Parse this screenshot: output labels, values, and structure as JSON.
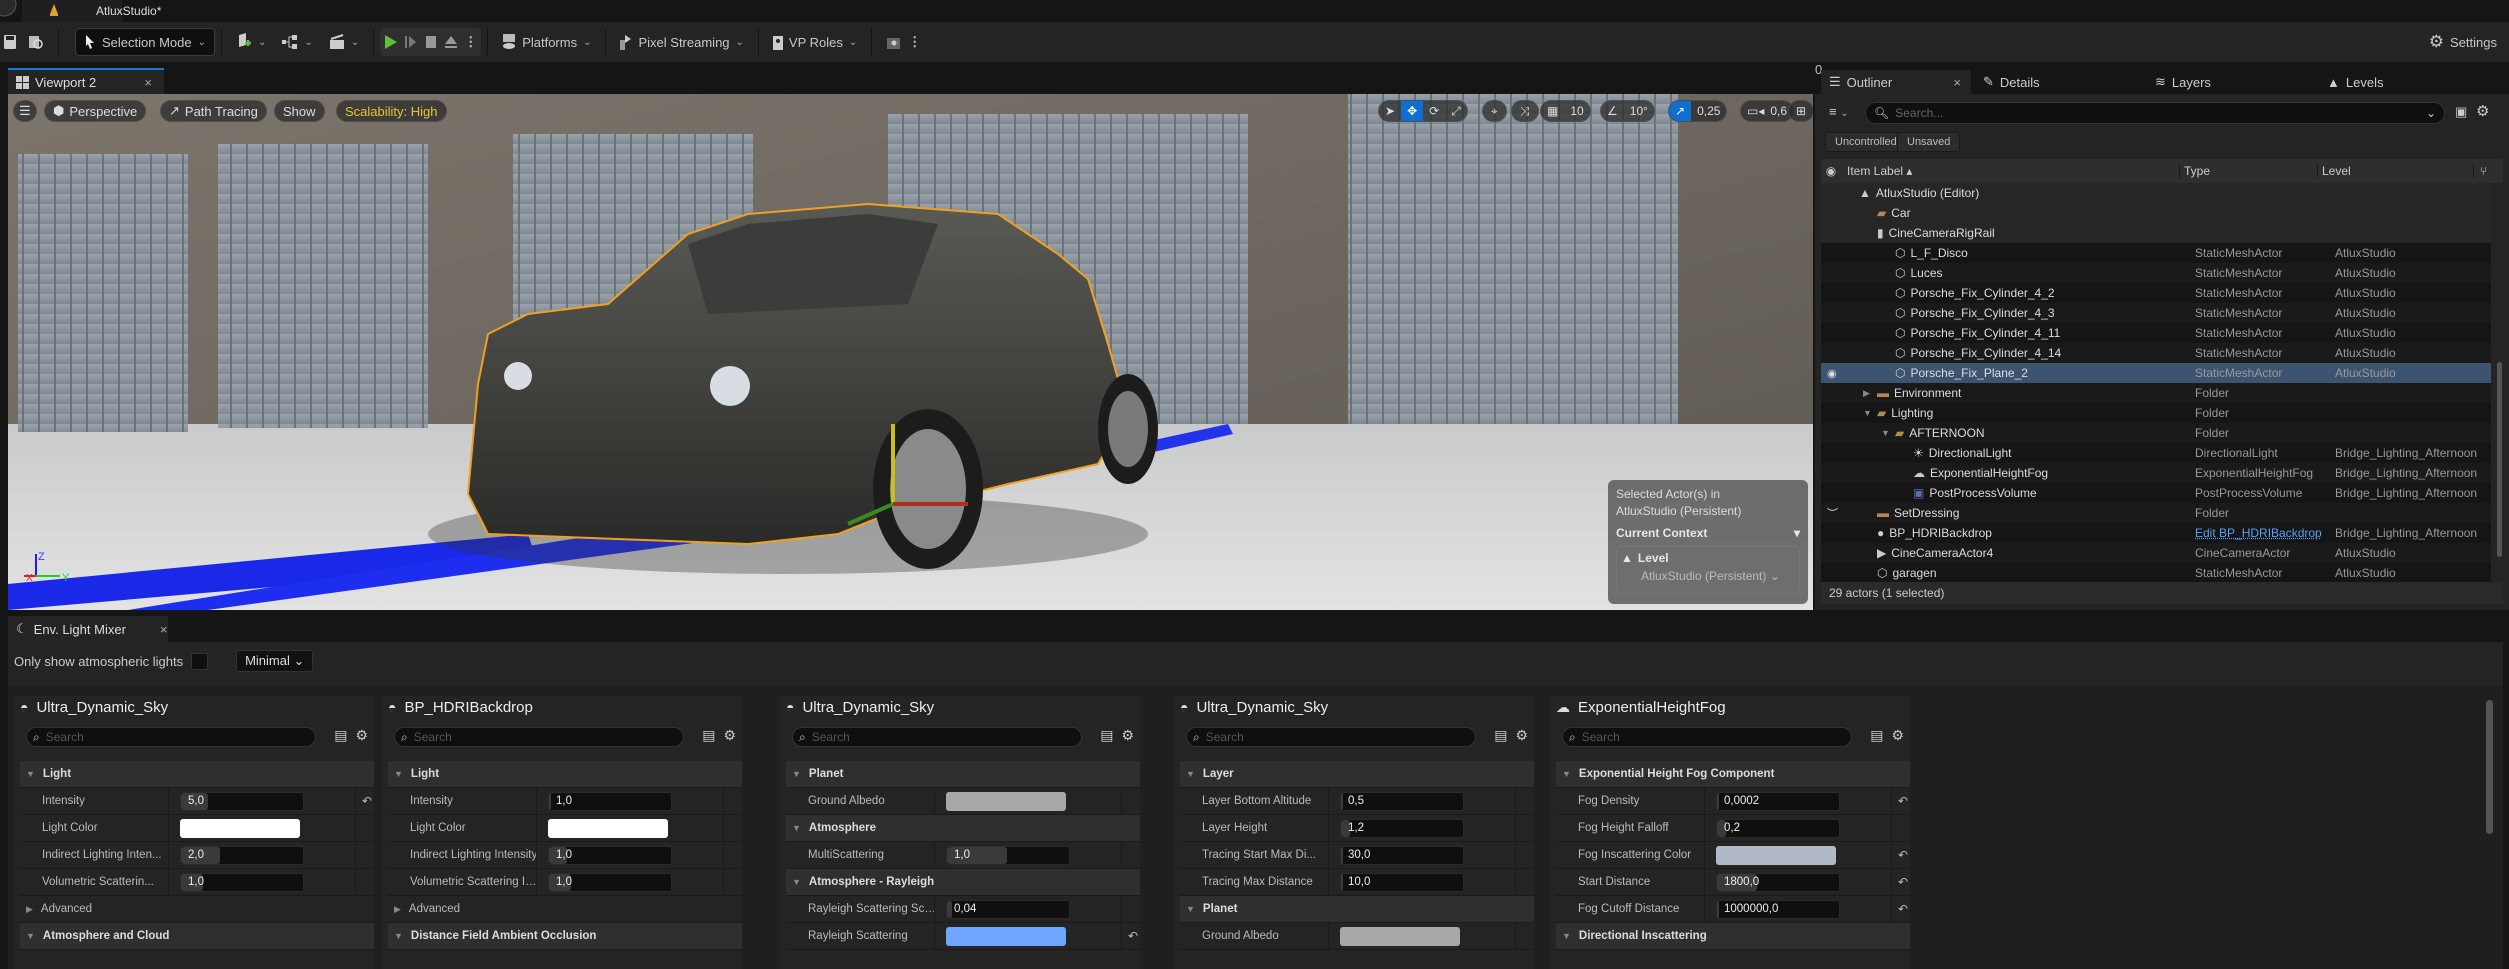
{
  "title_bar": {
    "doc_title": "AtluxStudio*"
  },
  "toolbar": {
    "selection_mode": "Selection Mode",
    "platforms": "Platforms",
    "pixel_streaming": "Pixel Streaming",
    "vp_roles": "VP Roles",
    "settings": "Settings"
  },
  "viewport": {
    "tab_label": "Viewport 2",
    "view_mode": "Perspective",
    "render_mode": "Path Tracing",
    "show": "Show",
    "scalability": "Scalability: High",
    "grid_snap": "10",
    "rotation_snap": "10°",
    "scale_snap": "0,25",
    "camera_speed": "0,6",
    "axis_labels": {
      "z": "Z",
      "y": "Y",
      "x": "X"
    },
    "context_box": {
      "line1": "Selected Actor(s) in",
      "line2": "AtluxStudio (Persistent)",
      "heading": "Current Context",
      "level_label": "Level",
      "level_value": "AtluxStudio (Persistent)"
    }
  },
  "outliner": {
    "tabs": [
      "Outliner",
      "Details",
      "Layers",
      "Levels"
    ],
    "search_placeholder": "Search...",
    "chips": [
      "Uncontrolled",
      "Unsaved"
    ],
    "columns": {
      "label": "Item Label",
      "type": "Type",
      "level": "Level"
    },
    "rows": [
      {
        "label": "AtluxStudio (Editor)",
        "type": "",
        "level": "",
        "icon": "level-icon",
        "indent": 1,
        "kind": "folder"
      },
      {
        "label": "Car",
        "type": "",
        "level": "",
        "icon": "folder-open-icon",
        "indent": 2,
        "kind": "folder"
      },
      {
        "label": "CineCameraRigRail",
        "type": "",
        "level": "",
        "icon": "camera-rail-icon",
        "indent": 2,
        "kind": "folder"
      },
      {
        "label": "L_F_Disco",
        "type": "StaticMeshActor",
        "level": "AtluxStudio",
        "icon": "static-mesh-icon",
        "indent": 3
      },
      {
        "label": "Luces",
        "type": "StaticMeshActor",
        "level": "AtluxStudio",
        "icon": "static-mesh-icon",
        "indent": 3
      },
      {
        "label": "Porsche_Fix_Cylinder_4_2",
        "type": "StaticMeshActor",
        "level": "AtluxStudio",
        "icon": "static-mesh-icon",
        "indent": 3
      },
      {
        "label": "Porsche_Fix_Cylinder_4_3",
        "type": "StaticMeshActor",
        "level": "AtluxStudio",
        "icon": "static-mesh-icon",
        "indent": 3
      },
      {
        "label": "Porsche_Fix_Cylinder_4_11",
        "type": "StaticMeshActor",
        "level": "AtluxStudio",
        "icon": "static-mesh-icon",
        "indent": 3
      },
      {
        "label": "Porsche_Fix_Cylinder_4_14",
        "type": "StaticMeshActor",
        "level": "AtluxStudio",
        "icon": "static-mesh-icon",
        "indent": 3
      },
      {
        "label": "Porsche_Fix_Plane_2",
        "type": "StaticMeshActor",
        "level": "AtluxStudio",
        "icon": "static-mesh-icon",
        "indent": 3,
        "selected": true
      },
      {
        "label": "Environment",
        "type": "Folder",
        "level": "",
        "icon": "folder-icon",
        "indent": 2,
        "arrow": "right"
      },
      {
        "label": "Lighting",
        "type": "Folder",
        "level": "",
        "icon": "folder-open-icon",
        "indent": 2,
        "arrow": "down"
      },
      {
        "label": "AFTERNOON",
        "type": "Folder",
        "level": "",
        "icon": "folder-open-icon",
        "indent": 3,
        "arrow": "down"
      },
      {
        "label": "DirectionalLight",
        "type": "DirectionalLight",
        "level": "Bridge_Lighting_Afternoon",
        "icon": "directional-light-icon",
        "indent": 4
      },
      {
        "label": "ExponentialHeightFog",
        "type": "ExponentialHeightFog",
        "level": "Bridge_Lighting_Afternoon",
        "icon": "fog-icon",
        "indent": 4
      },
      {
        "label": "PostProcessVolume",
        "type": "PostProcessVolume",
        "level": "Bridge_Lighting_Afternoon",
        "icon": "post-process-icon",
        "indent": 4
      },
      {
        "label": "SetDressing",
        "type": "Folder",
        "level": "",
        "icon": "folder-icon",
        "indent": 2,
        "hidden": true
      },
      {
        "label": "BP_HDRIBackdrop",
        "type": "Edit BP_HDRIBackdrop",
        "level": "Bridge_Lighting_Afternoon",
        "icon": "blueprint-icon",
        "indent": 2,
        "link": true
      },
      {
        "label": "CineCameraActor4",
        "type": "CineCameraActor",
        "level": "AtluxStudio",
        "icon": "cine-camera-icon",
        "indent": 2
      },
      {
        "label": "garagen",
        "type": "StaticMeshActor",
        "level": "AtluxStudio",
        "icon": "static-mesh-icon",
        "indent": 2
      }
    ],
    "status": "29 actors (1 selected)"
  },
  "mixer": {
    "tab_label": "Env. Light Mixer",
    "only_atmospheric_label": "Only show atmospheric lights",
    "only_atmospheric_checked": false,
    "view_mode": "Minimal",
    "search_placeholder": "Search",
    "panels": [
      {
        "title": "Ultra_Dynamic_Sky",
        "icon": "sky-icon",
        "rows": [
          {
            "kind": "cat",
            "label": "Light",
            "open": true
          },
          {
            "kind": "num",
            "label": "Intensity",
            "value": "5,0",
            "fill": 0.22,
            "reset": true
          },
          {
            "kind": "color",
            "label": "Light Color",
            "color": "#ffffff"
          },
          {
            "kind": "num",
            "label": "Indirect Lighting Inten...",
            "value": "2,0",
            "fill": 0.32
          },
          {
            "kind": "num",
            "label": "Volumetric Scatterin...",
            "value": "1,0",
            "fill": 0.18
          },
          {
            "kind": "cat",
            "label": "Advanced",
            "open": false,
            "sub": true
          },
          {
            "kind": "cat",
            "label": "Atmosphere and Cloud",
            "open": true
          }
        ]
      },
      {
        "title": "BP_HDRIBackdrop",
        "icon": "sky-icon",
        "rows": [
          {
            "kind": "cat",
            "label": "Light",
            "open": true
          },
          {
            "kind": "num",
            "label": "Intensity",
            "value": "1,0",
            "fill": 0.02
          },
          {
            "kind": "color",
            "label": "Light Color",
            "color": "#ffffff"
          },
          {
            "kind": "num",
            "label": "Indirect Lighting Intensity",
            "value": "1,0",
            "fill": 0.15
          },
          {
            "kind": "num",
            "label": "Volumetric Scattering In...",
            "value": "1,0",
            "fill": 0.18
          },
          {
            "kind": "cat",
            "label": "Advanced",
            "open": false,
            "sub": true
          },
          {
            "kind": "cat",
            "label": "Distance Field Ambient Occlusion",
            "open": true
          }
        ]
      },
      {
        "title": "Ultra_Dynamic_Sky",
        "icon": "sky-icon",
        "rows": [
          {
            "kind": "cat",
            "label": "Planet",
            "open": true
          },
          {
            "kind": "color",
            "label": "Ground Albedo",
            "color": "#a8a8a8"
          },
          {
            "kind": "cat",
            "label": "Atmosphere",
            "open": true
          },
          {
            "kind": "num",
            "label": "MultiScattering",
            "value": "1,0",
            "fill": 0.49
          },
          {
            "kind": "cat",
            "label": "Atmosphere - Rayleigh",
            "open": true
          },
          {
            "kind": "num",
            "label": "Rayleigh Scattering Scale",
            "value": "0,04",
            "fill": 0.04
          },
          {
            "kind": "color",
            "label": "Rayleigh Scattering",
            "color": "#6ea6ff",
            "reset": true
          }
        ]
      },
      {
        "title": "Ultra_Dynamic_Sky",
        "icon": "sky-icon",
        "rows": [
          {
            "kind": "cat",
            "label": "Layer",
            "open": true
          },
          {
            "kind": "num",
            "label": "Layer Bottom Altitude",
            "value": "0,5",
            "fill": 0.01
          },
          {
            "kind": "num",
            "label": "Layer Height",
            "value": "1,2",
            "fill": 0.07
          },
          {
            "kind": "num",
            "label": "Tracing Start Max Di...",
            "value": "30,0",
            "fill": 0
          },
          {
            "kind": "num",
            "label": "Tracing Max Distance",
            "value": "10,0",
            "fill": 0
          },
          {
            "kind": "cat",
            "label": "Planet",
            "open": true
          },
          {
            "kind": "color",
            "label": "Ground Albedo",
            "color": "#a8a8a8"
          }
        ]
      },
      {
        "title": "ExponentialHeightFog",
        "icon": "fog-icon",
        "rows": [
          {
            "kind": "cat",
            "label": "Exponential Height Fog Component",
            "open": true
          },
          {
            "kind": "num",
            "label": "Fog Density",
            "value": "0,0002",
            "fill": 0,
            "reset": true
          },
          {
            "kind": "num",
            "label": "Fog Height Falloff",
            "value": "0,2",
            "fill": 0.07
          },
          {
            "kind": "color",
            "label": "Fog Inscattering Color",
            "color": "#b2b9c6",
            "reset": true
          },
          {
            "kind": "num",
            "label": "Start Distance",
            "value": "1800,0",
            "fill": 0.33,
            "reset": true
          },
          {
            "kind": "num",
            "label": "Fog Cutoff Distance",
            "value": "1000000,0",
            "fill": 0.01,
            "reset": true
          },
          {
            "kind": "cat",
            "label": "Directional Inscattering",
            "open": true
          }
        ]
      }
    ]
  },
  "colors": {
    "accent": "#0e6fd1",
    "selection_outline": "#f0a020",
    "scalability": "#e8c530",
    "selected_row": "#3d5470"
  }
}
